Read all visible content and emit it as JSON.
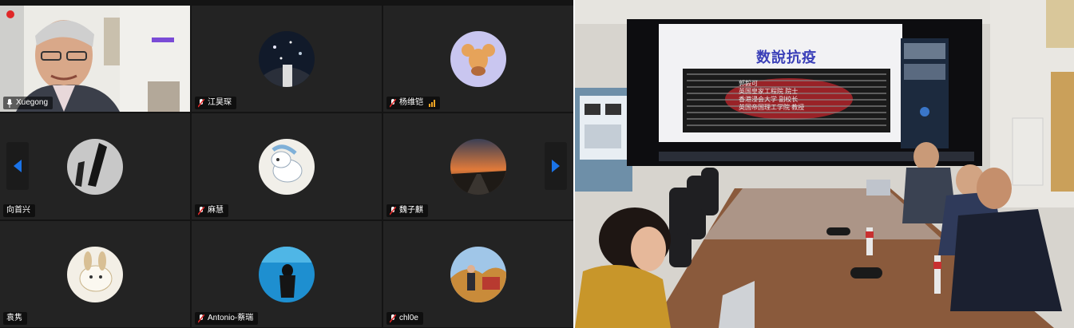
{
  "participants": [
    {
      "name": "Xuegong",
      "mic": "unmuted"
    },
    {
      "name": "江昊琛",
      "mic": "muted"
    },
    {
      "name": "杨维铠",
      "mic": "muted",
      "signal_bars": 3
    },
    {
      "name": "向首兴",
      "mic": "none"
    },
    {
      "name": "麻慧",
      "mic": "muted"
    },
    {
      "name": "魏子麒",
      "mic": "muted"
    },
    {
      "name": "袁隽",
      "mic": "none"
    },
    {
      "name": "Antonio-蔡瑞",
      "mic": "muted"
    },
    {
      "name": "chl0e",
      "mic": "muted"
    }
  ],
  "slide": {
    "title": "数說抗疫",
    "lines": [
      "郭毅可",
      "英国皇家工程院 院士",
      "香港浸会大学 副校长",
      "英国帝国理工学院 教授"
    ]
  },
  "colors": {
    "accent_blue": "#1a73e8",
    "muted_red": "#e02828",
    "signal_orange": "#f6a623"
  },
  "icons": {
    "prev_page": "chevron-left-icon",
    "next_page": "chevron-right-icon",
    "mic": "microphone-icon",
    "mic_muted": "microphone-muted-icon"
  }
}
